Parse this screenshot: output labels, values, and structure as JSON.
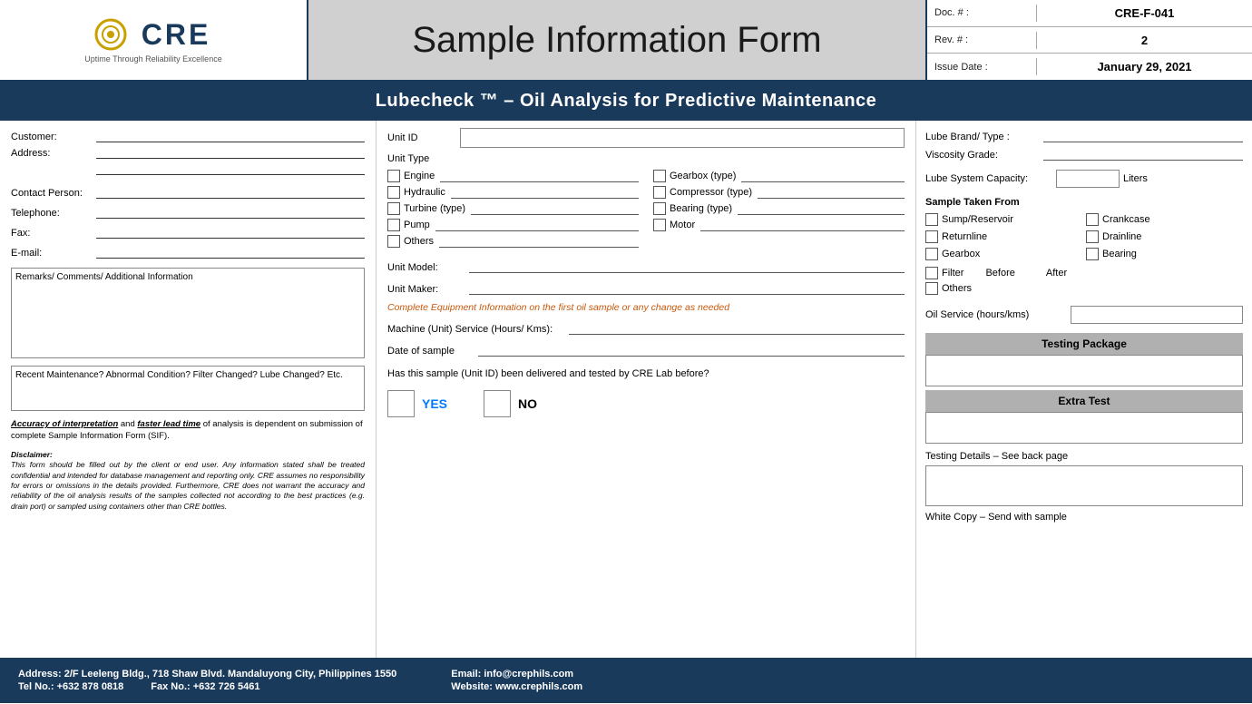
{
  "header": {
    "logo_brand": "CRE",
    "logo_tagline": "Uptime Through Reliability Excellence",
    "main_title": "Sample Information Form",
    "doc_label": "Doc. # :",
    "doc_value": "CRE-F-041",
    "rev_label": "Rev. # :",
    "rev_value": "2",
    "issue_label": "Issue Date :",
    "issue_value": "January 29, 2021"
  },
  "banner": {
    "text": "Lubecheck ™ – Oil Analysis for Predictive Maintenance"
  },
  "left": {
    "customer_label": "Customer:",
    "address_label": "Address:",
    "contact_label": "Contact Person:",
    "telephone_label": "Telephone:",
    "fax_label": "Fax:",
    "email_label": "E-mail:",
    "remarks_label": "Remarks/ Comments/ Additional Information",
    "maintenance_label": "Recent Maintenance? Abnormal Condition? Filter Changed? Lube Changed? Etc.",
    "accuracy_part1": "Accuracy of interpretation",
    "accuracy_part2": " and ",
    "accuracy_part3": "faster lead time",
    "accuracy_part4": " of analysis is dependent on submission of complete Sample Information Form (SIF).",
    "disclaimer_title": "Disclaimer:",
    "disclaimer_body": "This form should be filled out by the client or end user. Any information stated shall be treated confidential and intended for database management and reporting only. CRE assumes no responsibility for errors or omissions in the details provided. Furthermore, CRE does not warrant the accuracy and reliability of the oil analysis results of the samples collected not according to the best practices (e.g. drain port) or sampled using containers other than CRE bottles."
  },
  "middle": {
    "unit_id_label": "Unit ID",
    "unit_type_label": "Unit Type",
    "engine_label": "Engine",
    "hydraulic_label": "Hydraulic",
    "turbine_label": "Turbine (type)",
    "pump_label": "Pump",
    "others_label": "Others",
    "gearbox_label": "Gearbox (type)",
    "compressor_label": "Compressor (type)",
    "bearing_label": "Bearing (type)",
    "motor_label": "Motor",
    "unit_model_label": "Unit Model:",
    "unit_maker_label": "Unit Maker:",
    "complete_notice": "Complete Equipment Information on the first oil sample or any change as needed",
    "machine_service_label": "Machine (Unit) Service (Hours/ Kms):",
    "date_label": "Date of sample",
    "delivered_question": "Has this sample (Unit ID) been delivered and tested by CRE Lab before?",
    "yes_label": "YES",
    "no_label": "NO"
  },
  "right": {
    "lube_brand_label": "Lube Brand/ Type :",
    "viscosity_label": "Viscosity Grade:",
    "lube_capacity_label": "Lube System Capacity:",
    "liters_label": "Liters",
    "sample_taken_label": "Sample Taken From",
    "sump_label": "Sump/Reservoir",
    "crankcase_label": "Crankcase",
    "returnline_label": "Returnline",
    "drainline_label": "Drainline",
    "gearbox_label": "Gearbox",
    "bearing_label": "Bearing",
    "filter_label": "Filter",
    "before_label": "Before",
    "after_label": "After",
    "others_label": "Others",
    "oil_service_label": "Oil Service (hours/kms)",
    "testing_package_header": "Testing Package",
    "extra_test_header": "Extra Test",
    "testing_details_label": "Testing Details – See back page",
    "white_copy_label": "White Copy – Send with sample"
  },
  "footer": {
    "address": "Address: 2/F Leeleng Bldg., 718 Shaw Blvd. Mandaluyong City, Philippines 1550",
    "tel": "Tel No.: +632 878 0818",
    "fax": "Fax No.: +632 726 5461",
    "email": "Email: info@crephils.com",
    "website": "Website: www.crephils.com"
  }
}
